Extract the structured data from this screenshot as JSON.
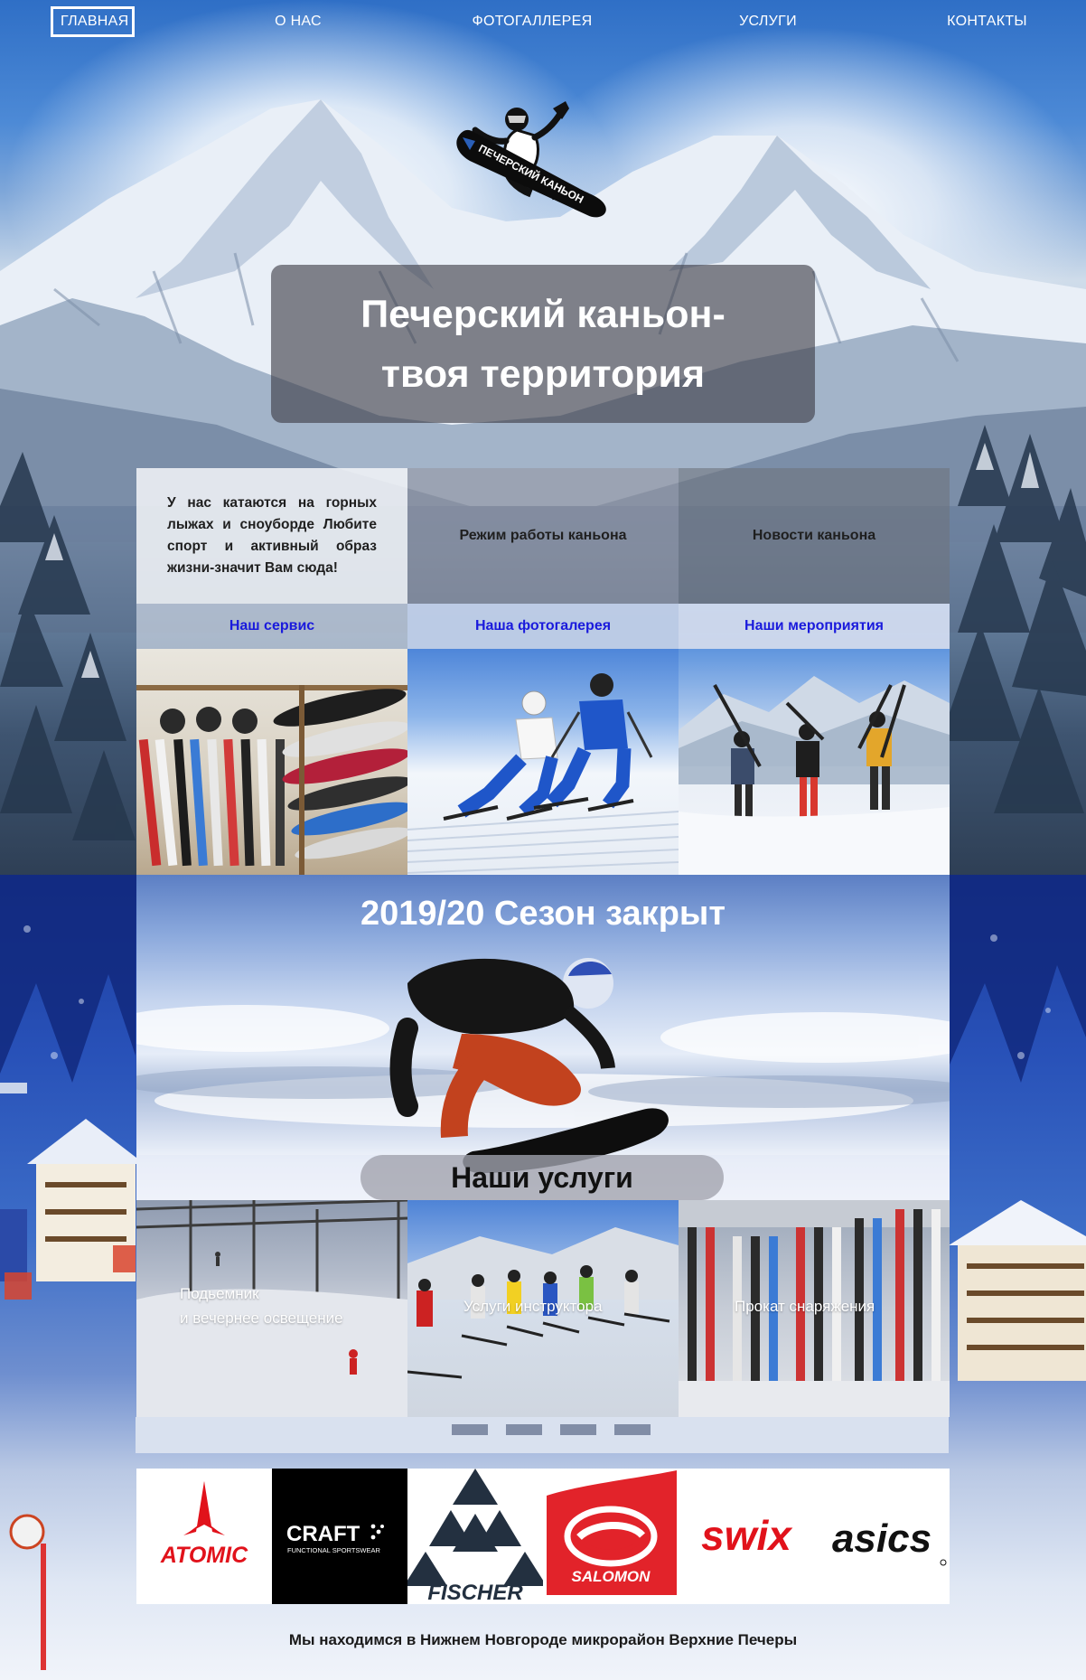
{
  "nav": {
    "items": [
      {
        "label": "ГЛАВНАЯ",
        "active": true
      },
      {
        "label": "О НАС"
      },
      {
        "label": "ФОТОГАЛЛЕРЕЯ"
      },
      {
        "label": "УСЛУГИ"
      },
      {
        "label": "КОНТАКТЫ"
      }
    ]
  },
  "logo": {
    "text": "ПЕЧЕРСКИЙ КАНЬОН",
    "icon": "snowboarder-logo"
  },
  "hero": {
    "line1": "Печерский каньон-",
    "line2": "твоя территория"
  },
  "info": {
    "about": "У нас катаются на горных лыжах и сноуборде Любите спорт и активный образ жизни-значит Вам сюда!",
    "hours": "Режим работы каньона",
    "news": "Новости каньона"
  },
  "links": {
    "service": "Наш сервис",
    "gallery": "Наша фотогалерея",
    "events": "Наши мероприятия"
  },
  "season": {
    "title": "2019/20 Сезон закрыт"
  },
  "services": {
    "title": "Наши услуги",
    "items": [
      {
        "line1": "Подьемник",
        "line2": "и вечернее освещение"
      },
      {
        "line1": "Услуги инструктора"
      },
      {
        "line1": "Прокат снаряжения"
      }
    ]
  },
  "brands": {
    "atomic": "ATOMIC",
    "craft": "CRAFT",
    "craft_sub": "FUNCTIONAL SPORTSWEAR",
    "fischer": "FISCHER",
    "salomon": "SALOMON",
    "swix": "swix",
    "asics": "asics"
  },
  "footer": {
    "text": "Мы находимся в Нижнем Новгороде микрорайон Верхние Печеры"
  },
  "colors": {
    "link": "#1a1adc",
    "atomic_red": "#e1121b",
    "salomon_red": "#e2232a"
  }
}
